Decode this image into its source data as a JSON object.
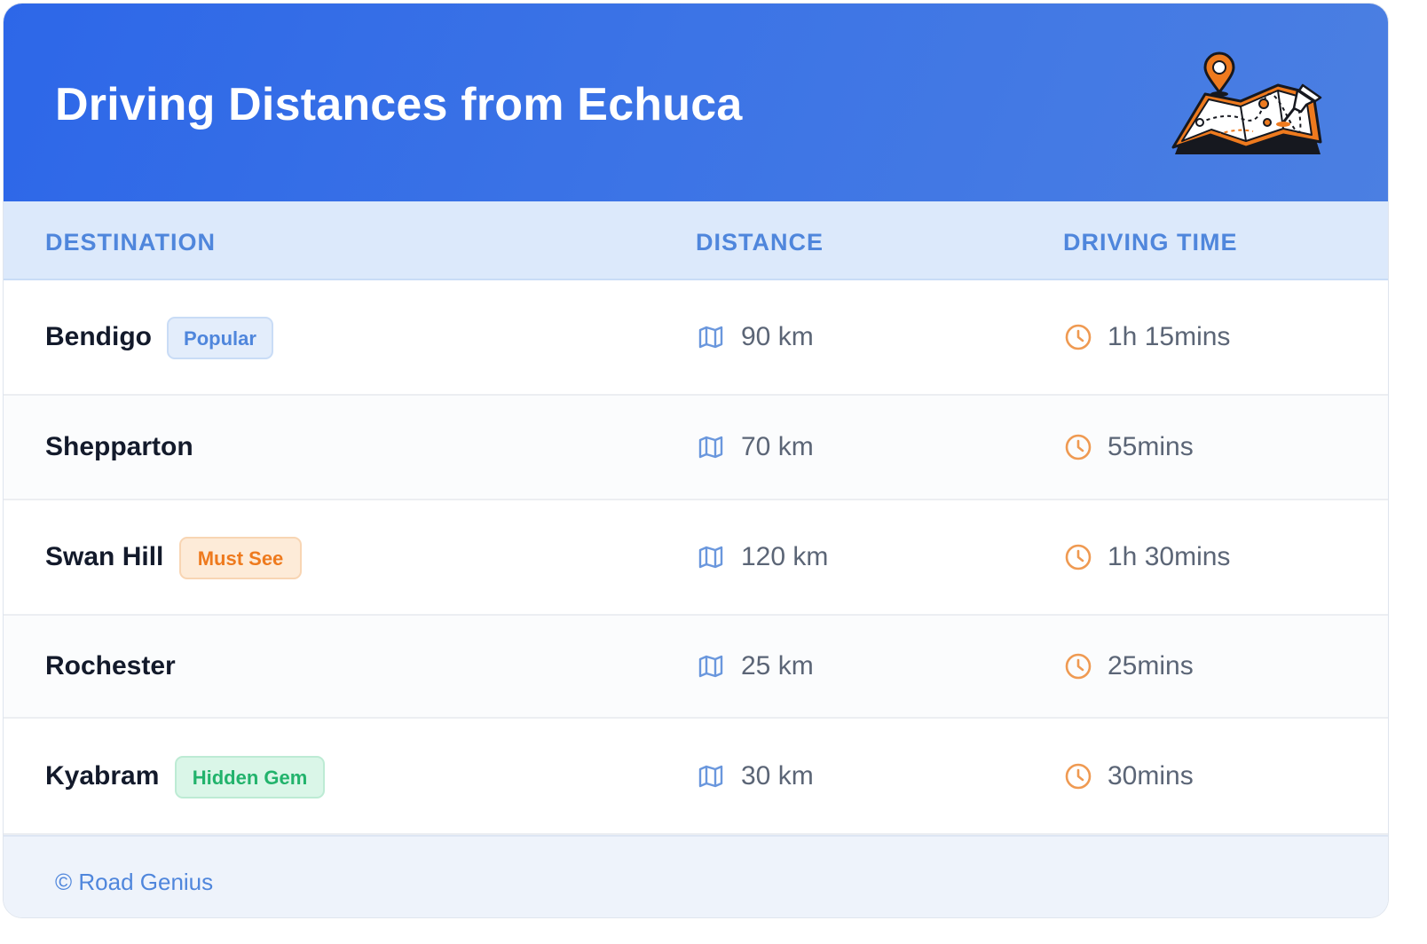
{
  "header": {
    "title": "Driving Distances from Echuca",
    "illustration_icon": "map-with-pins-icon"
  },
  "table": {
    "columns": [
      "DESTINATION",
      "DISTANCE",
      "DRIVING TIME"
    ],
    "rows": [
      {
        "destination": "Bendigo",
        "badge": "Popular",
        "badge_color": "blue",
        "distance": "90 km",
        "time": "1h 15mins"
      },
      {
        "destination": "Shepparton",
        "badge": "",
        "badge_color": "",
        "distance": "70 km",
        "time": "55mins"
      },
      {
        "destination": "Swan Hill",
        "badge": "Must See",
        "badge_color": "orange",
        "distance": "120 km",
        "time": "1h 30mins"
      },
      {
        "destination": "Rochester",
        "badge": "",
        "badge_color": "",
        "distance": "25 km",
        "time": "25mins"
      },
      {
        "destination": "Kyabram",
        "badge": "Hidden Gem",
        "badge_color": "green",
        "distance": "30 km",
        "time": "30mins"
      }
    ],
    "distance_icon": "map-icon",
    "time_icon": "clock-icon"
  },
  "footer": {
    "text": "© Road Genius"
  },
  "colors": {
    "header_gradient_start": "#2d67e8",
    "header_gradient_end": "#4b7fe2",
    "accent_blue": "#4f86dc",
    "accent_orange": "#ee7a1e",
    "accent_green": "#22b36c"
  }
}
